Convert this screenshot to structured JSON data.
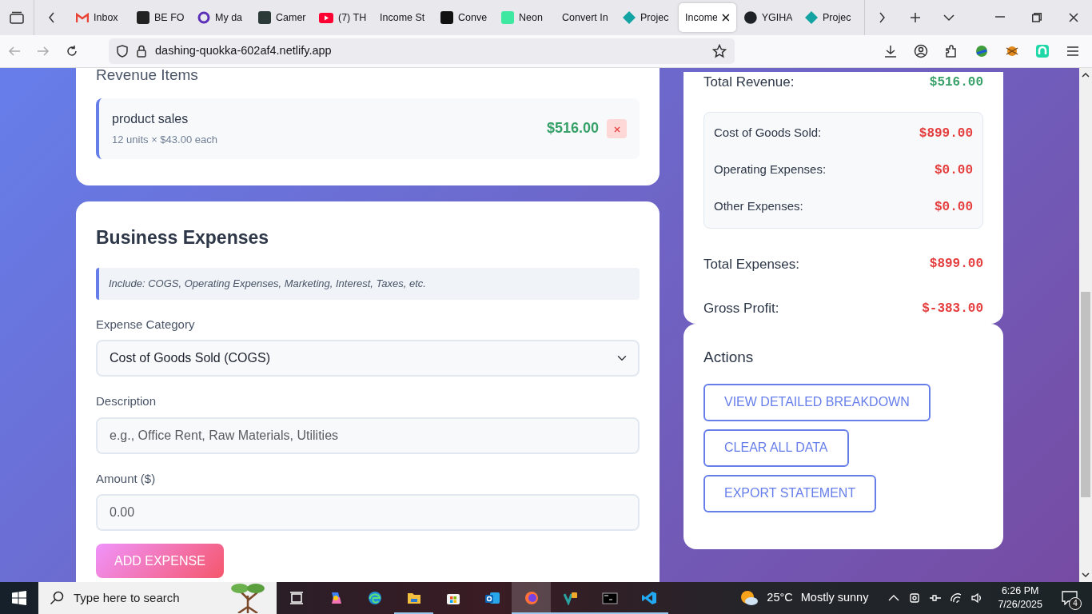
{
  "browser": {
    "tabs": [
      {
        "label": "Inbox",
        "kind": "mail",
        "color": "#ea4335",
        "selected": false
      },
      {
        "label": "BE FO",
        "kind": "square",
        "color": "#222222",
        "selected": false
      },
      {
        "label": "My da",
        "kind": "ring",
        "color": "#5b2fb8",
        "selected": false
      },
      {
        "label": "Camer",
        "kind": "square",
        "color": "#2b3a36",
        "selected": false
      },
      {
        "label": "(7) TH",
        "kind": "play",
        "color": "#ff0033",
        "selected": false
      },
      {
        "label": "Income St",
        "kind": "none",
        "selected": false
      },
      {
        "label": "Conve",
        "kind": "square",
        "color": "#111111",
        "selected": false
      },
      {
        "label": "Neon",
        "kind": "square",
        "color": "#3ee8a0",
        "selected": false
      },
      {
        "label": "Convert In",
        "kind": "none",
        "selected": false
      },
      {
        "label": "Projec",
        "kind": "diamond",
        "color": "#14a3a3",
        "selected": false
      },
      {
        "label": "Income",
        "kind": "none",
        "selected": true
      },
      {
        "label": "YGIHA",
        "kind": "circle",
        "color": "#1f2328",
        "selected": false
      },
      {
        "label": "Projec",
        "kind": "diamond",
        "color": "#14a3a3",
        "selected": false
      }
    ],
    "url": "dashing-quokka-602af4.netlify.app"
  },
  "revenue_items": {
    "title": "Revenue Items",
    "items": [
      {
        "name": "product sales",
        "detail": "12 units × $43.00 each",
        "amount": "$516.00"
      }
    ]
  },
  "expenses": {
    "title": "Business Expenses",
    "note": "Include: COGS, Operating Expenses, Marketing, Interest, Taxes, etc.",
    "category_label": "Expense Category",
    "category_value": "Cost of Goods Sold (COGS)",
    "description_label": "Description",
    "description_placeholder": "e.g., Office Rent, Raw Materials, Utilities",
    "amount_label": "Amount ($)",
    "amount_placeholder": "0.00",
    "submit": "ADD EXPENSE"
  },
  "summary": {
    "total_revenue": {
      "label": "Total Revenue:",
      "value": "$516.00",
      "color": "#38a169"
    },
    "breakdown": [
      {
        "label": "Cost of Goods Sold:",
        "value": "$899.00",
        "color": "#e53e3e"
      },
      {
        "label": "Operating Expenses:",
        "value": "$0.00",
        "color": "#e53e3e"
      },
      {
        "label": "Other Expenses:",
        "value": "$0.00",
        "color": "#e53e3e"
      }
    ],
    "totals": [
      {
        "label": "Total Expenses:",
        "value": "$899.00",
        "color": "#e53e3e"
      },
      {
        "label": "Gross Profit:",
        "value": "$-383.00",
        "color": "#e53e3e"
      }
    ]
  },
  "actions": {
    "title": "Actions",
    "buttons": [
      "VIEW DETAILED BREAKDOWN",
      "CLEAR ALL DATA",
      "EXPORT STATEMENT"
    ]
  },
  "taskbar": {
    "search_placeholder": "Type here to search",
    "apps": [
      {
        "kind": "task-view",
        "selected": false,
        "running": false
      },
      {
        "kind": "copilot",
        "selected": false,
        "running": false
      },
      {
        "kind": "edge",
        "selected": false,
        "running": false
      },
      {
        "kind": "folder",
        "selected": false,
        "running": true
      },
      {
        "kind": "store",
        "selected": false,
        "running": false
      },
      {
        "kind": "outlook",
        "selected": false,
        "running": false
      },
      {
        "kind": "firefox",
        "selected": true,
        "running": true
      },
      {
        "kind": "vs-app",
        "selected": false,
        "running": true
      },
      {
        "kind": "terminal",
        "selected": false,
        "running": true
      },
      {
        "kind": "vscode",
        "selected": false,
        "running": true
      }
    ],
    "temperature": "25°C",
    "weather": "Mostly sunny",
    "time": "6:26 PM",
    "date": "7/26/2025",
    "notifications": "4"
  }
}
